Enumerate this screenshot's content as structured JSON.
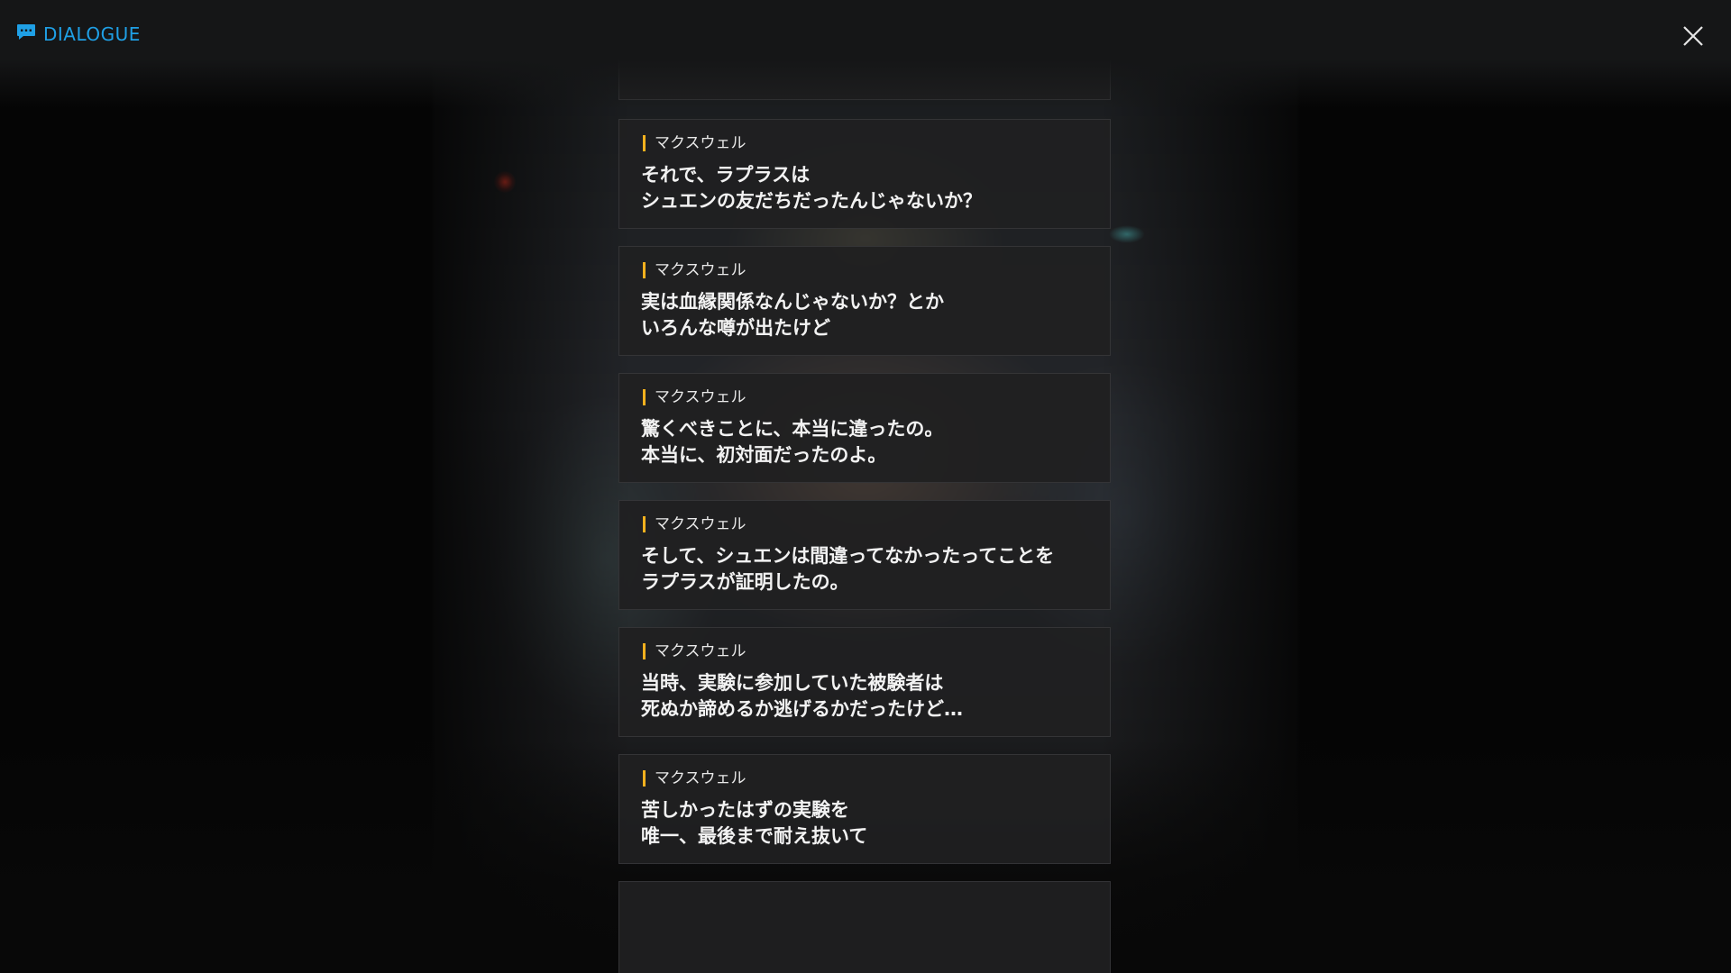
{
  "header": {
    "title": "DIALOGUE",
    "title_icon": "chat-bubble-icon",
    "close_icon": "close-x-icon",
    "accent_color": "#1fa0e6"
  },
  "dialogue": {
    "speaker_marker_color": "#f3b11e",
    "entries": [
      {
        "speaker": "マクスウェル",
        "line1": "それで、ラプラスは",
        "line2": "シュエンの友だちだったんじゃないか？"
      },
      {
        "speaker": "マクスウェル",
        "line1": "実は血縁関係なんじゃないか？とか",
        "line2": "いろんな噂が出たけど"
      },
      {
        "speaker": "マクスウェル",
        "line1": "驚くべきことに、本当に違ったの。",
        "line2": "本当に、初対面だったのよ。"
      },
      {
        "speaker": "マクスウェル",
        "line1": "そして、シュエンは間違ってなかったってことを",
        "line2": "ラプラスが証明したの。"
      },
      {
        "speaker": "マクスウェル",
        "line1": "当時、実験に参加していた被験者は",
        "line2": "死ぬか諦めるか逃げるかだったけど…"
      },
      {
        "speaker": "マクスウェル",
        "line1": "苦しかったはずの実験を",
        "line2": "唯一、最後まで耐え抜いて"
      }
    ]
  }
}
